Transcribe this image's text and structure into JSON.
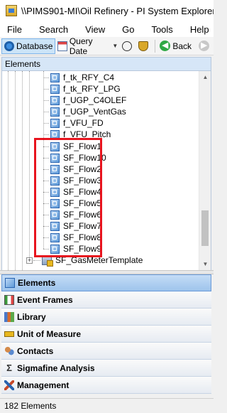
{
  "window": {
    "title": "\\\\PIMS901-MI\\Oil Refinery - PI System Explorer"
  },
  "menu": [
    "File",
    "Search",
    "View",
    "Go",
    "Tools",
    "Help"
  ],
  "toolbar": {
    "database_label": "Database",
    "query_date_label": "Query Date",
    "back_label": "Back"
  },
  "elements_panel": {
    "header": "Elements",
    "tree_items": [
      "f_tk_RFY_C4",
      "f_tk_RFY_LPG",
      "f_UGP_C4OLEF",
      "f_UGP_VentGas",
      "f_VFU_FD",
      "f_VFU_Pitch",
      "SF_Flow1",
      "SF_Flow10",
      "SF_Flow2",
      "SF_Flow3",
      "SF_Flow4",
      "SF_Flow5",
      "SF_Flow6",
      "SF_Flow7",
      "SF_Flow8",
      "SF_Flow9"
    ],
    "template_item": "SF_GasMeterTemplate",
    "highlight_color": "#e8141e"
  },
  "navigation": [
    {
      "label": "Elements",
      "icon": "elements-icon",
      "selected": true
    },
    {
      "label": "Event Frames",
      "icon": "event-frames-icon",
      "selected": false
    },
    {
      "label": "Library",
      "icon": "library-icon",
      "selected": false
    },
    {
      "label": "Unit of Measure",
      "icon": "ruler-icon",
      "selected": false
    },
    {
      "label": "Contacts",
      "icon": "contacts-icon",
      "selected": false
    },
    {
      "label": "Sigmafine Analysis",
      "icon": "sigma-icon",
      "selected": false
    },
    {
      "label": "Management",
      "icon": "tools-icon",
      "selected": false
    }
  ],
  "status": {
    "count_text": "182 Elements"
  }
}
